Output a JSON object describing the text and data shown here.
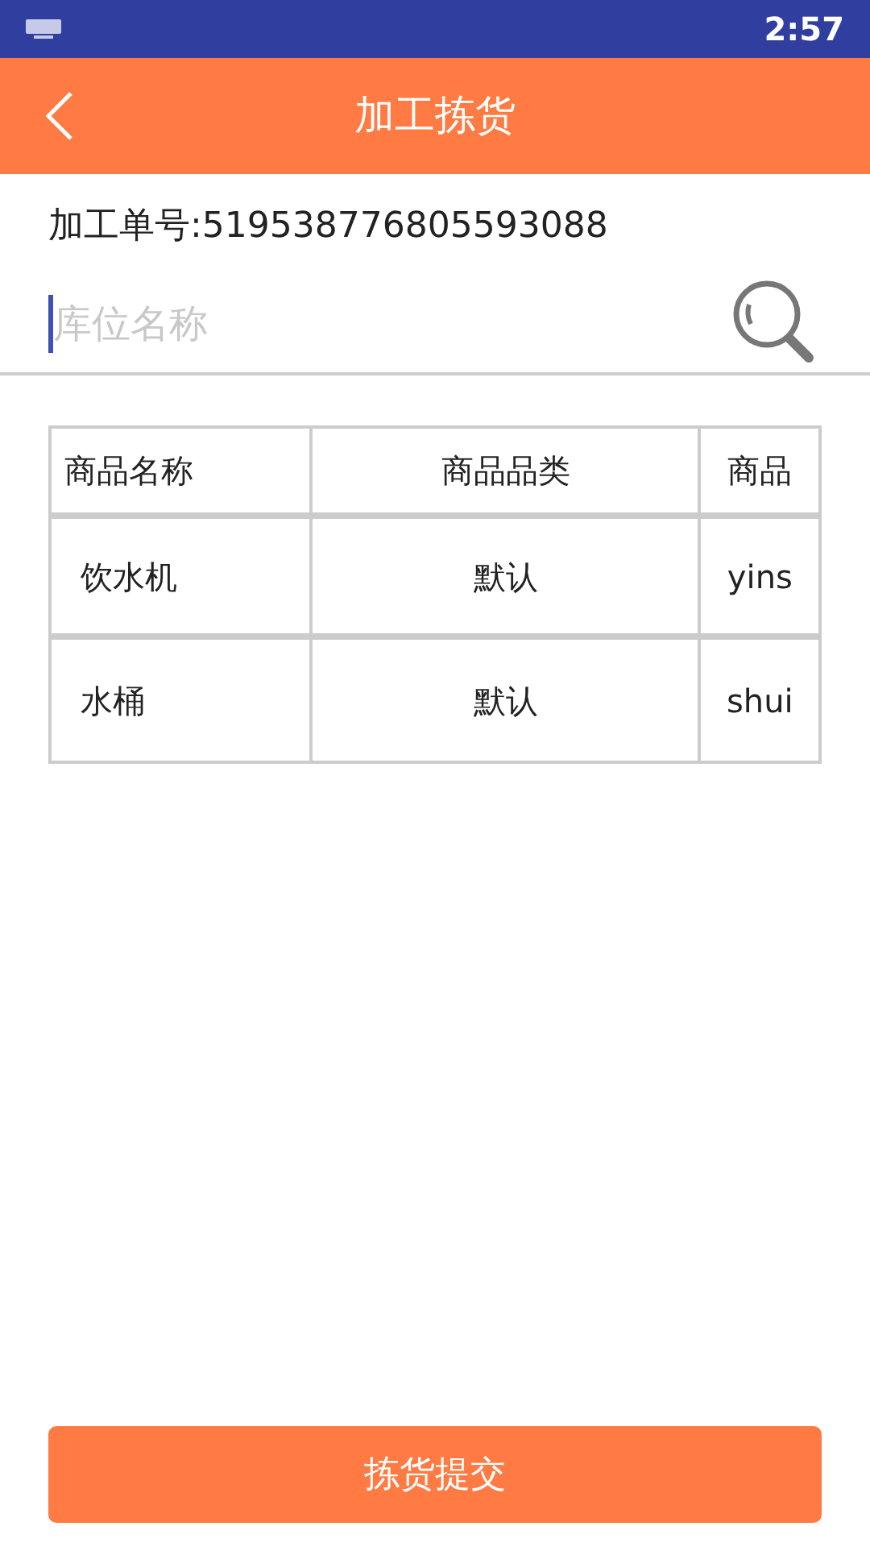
{
  "status_bar": {
    "time": "2:57"
  },
  "header": {
    "title": "加工拣货"
  },
  "order": {
    "text": "加工单号:519538776805593088"
  },
  "search": {
    "placeholder": "库位名称"
  },
  "table": {
    "columns": [
      "商品名称",
      "商品品类",
      "商品"
    ],
    "rows": [
      [
        "饮水机",
        "默认",
        "yins"
      ],
      [
        "水桶",
        "默认",
        "shui"
      ]
    ]
  },
  "submit_button": "拣货提交"
}
